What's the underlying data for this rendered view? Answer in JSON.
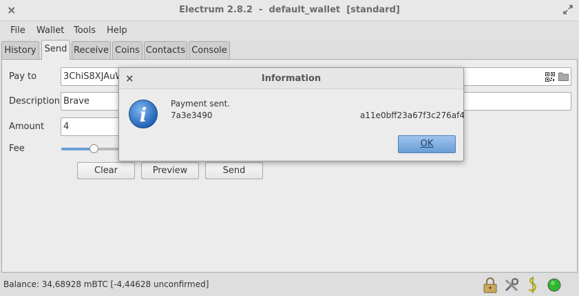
{
  "window": {
    "title": "Electrum 2.8.2  -  default_wallet  [standard]",
    "close_glyph": "×"
  },
  "menu": {
    "file": "File",
    "wallet": "Wallet",
    "tools": "Tools",
    "help": "Help"
  },
  "tabs": {
    "history": "History",
    "send": "Send",
    "receive": "Receive",
    "coins": "Coins",
    "contacts": "Contacts",
    "console": "Console"
  },
  "send_form": {
    "pay_to_label": "Pay to",
    "pay_to_value": "3ChiS8XJAuWm",
    "description_label": "Description",
    "description_value": "Brave",
    "amount_label": "Amount",
    "amount_value": "4",
    "fee_label": "Fee",
    "fee_slider_level": 0.4,
    "clear_label": "Clear",
    "preview_label": "Preview",
    "send_label": "Send"
  },
  "status": {
    "balance": "Balance: 34,68928 mBTC  [-4,44628 unconfirmed]",
    "connection_color": "#2eb82e"
  },
  "dialog": {
    "title": "Information",
    "close_glyph": "×",
    "message": "Payment sent.",
    "txid_start": "7a3e3490",
    "txid_end": "a11e0bff23a67f3c276af4",
    "ok_label": "OK"
  },
  "icons": {
    "qr": "qr-code-icon",
    "folder": "folder-icon",
    "lock": "lock-icon",
    "tools": "preferences-icon",
    "seed": "seed-icon",
    "network": "network-status-icon",
    "info": "information-icon"
  }
}
